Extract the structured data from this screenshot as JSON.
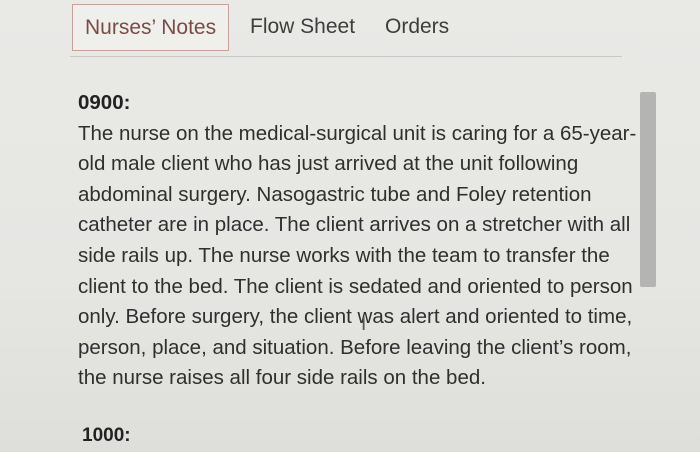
{
  "tabs": [
    {
      "label": "Nurses’ Notes",
      "active": true
    },
    {
      "label": "Flow Sheet",
      "active": false
    },
    {
      "label": "Orders",
      "active": false
    }
  ],
  "note": {
    "time_1": "0900:",
    "lines": [
      "The nurse on the medical-surgical unit is caring for a 65-year-",
      "old male client who has just arrived at the unit following",
      "abdominal surgery. Nasogastric tube and Foley retention",
      "catheter are in place. The client arrives on a stretcher with all",
      "side rails up. The nurse works with the team to transfer the",
      "client to the bed. The client is sedated and oriented to person",
      "only. Before surgery, the client was alert and oriented to time,",
      "person, place, and situation. Before leaving the client’s room,",
      "the nurse raises all four side rails on the bed."
    ],
    "time_2": "1000:"
  },
  "colors": {
    "active_tab_border": "#c9a19b",
    "active_tab_text": "#7a4c46",
    "scrollbar": "#b4b4b2"
  }
}
